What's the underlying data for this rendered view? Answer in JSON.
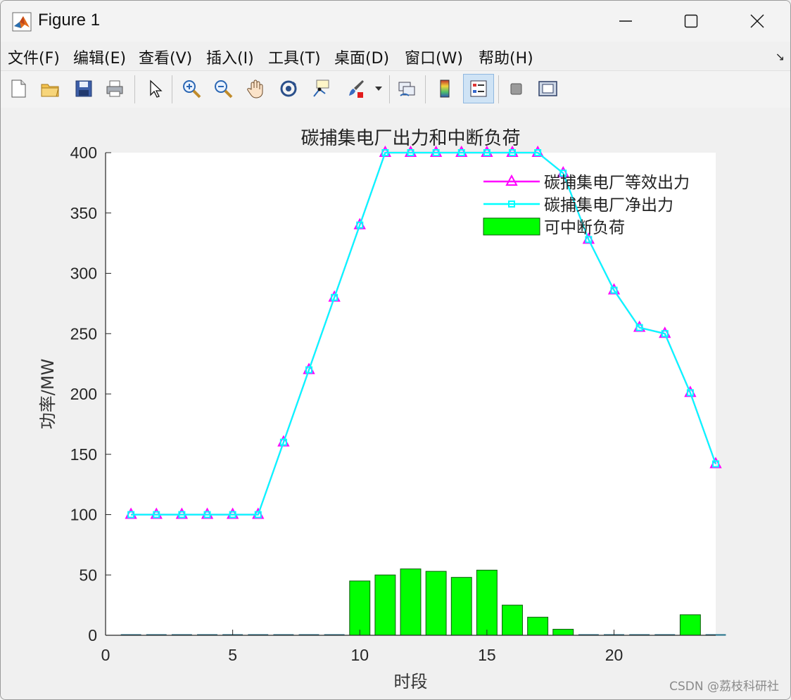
{
  "window": {
    "title": "Figure 1",
    "controls": {
      "minimize": "minimize",
      "maximize": "maximize",
      "close": "close"
    }
  },
  "menu": [
    "文件(F)",
    "编辑(E)",
    "查看(V)",
    "插入(I)",
    "工具(T)",
    "桌面(D)",
    "窗口(W)",
    "帮助(H)"
  ],
  "toolbar": [
    "new-figure-icon",
    "open-file-icon",
    "save-icon",
    "print-icon",
    "select-arrow-icon",
    "zoom-in-icon",
    "zoom-out-icon",
    "pan-hand-icon",
    "rotate-3d-icon",
    "data-cursor-icon",
    "brush-icon",
    "brush-dropdown-icon",
    "link-plot-icon",
    "colorbar-icon",
    "legend-icon",
    "hide-plot-tools-icon",
    "show-plot-tools-icon"
  ],
  "chart_data": {
    "type": "line",
    "title": "碳捕集电厂出力和中断负荷",
    "xlabel": "时段",
    "ylabel": "功率/MW",
    "xlim": [
      0,
      24
    ],
    "ylim": [
      0,
      400
    ],
    "xticks": [
      0,
      5,
      10,
      15,
      20
    ],
    "yticks": [
      0,
      50,
      100,
      150,
      200,
      250,
      300,
      350,
      400
    ],
    "x": [
      1,
      2,
      3,
      4,
      5,
      6,
      7,
      8,
      9,
      10,
      11,
      12,
      13,
      14,
      15,
      16,
      17,
      18,
      19,
      20,
      21,
      22,
      23,
      24
    ],
    "series": [
      {
        "name": "碳捕集电厂等效出力",
        "type": "line",
        "marker": "triangle",
        "color": "#ff00ff",
        "values": [
          100,
          100,
          100,
          100,
          100,
          100,
          160,
          220,
          280,
          340,
          400,
          400,
          400,
          400,
          400,
          400,
          400,
          383,
          328,
          286,
          255,
          250,
          201,
          142
        ]
      },
      {
        "name": "碳捕集电厂净出力",
        "type": "line",
        "marker": "square",
        "color": "#00ffff",
        "values": [
          100,
          100,
          100,
          100,
          100,
          100,
          160,
          220,
          280,
          340,
          400,
          400,
          400,
          400,
          400,
          400,
          400,
          383,
          328,
          286,
          255,
          250,
          201,
          142
        ]
      },
      {
        "name": "可中断负荷",
        "type": "bar",
        "color": "#00ff00",
        "values": [
          0,
          0,
          0,
          0,
          0,
          0,
          0,
          0,
          0,
          45,
          50,
          55,
          53,
          48,
          54,
          25,
          15,
          5,
          0,
          0,
          0,
          0,
          17,
          0
        ]
      }
    ],
    "legend_position": "top-right",
    "grid": false
  },
  "watermark": "CSDN @荔枝科研社"
}
